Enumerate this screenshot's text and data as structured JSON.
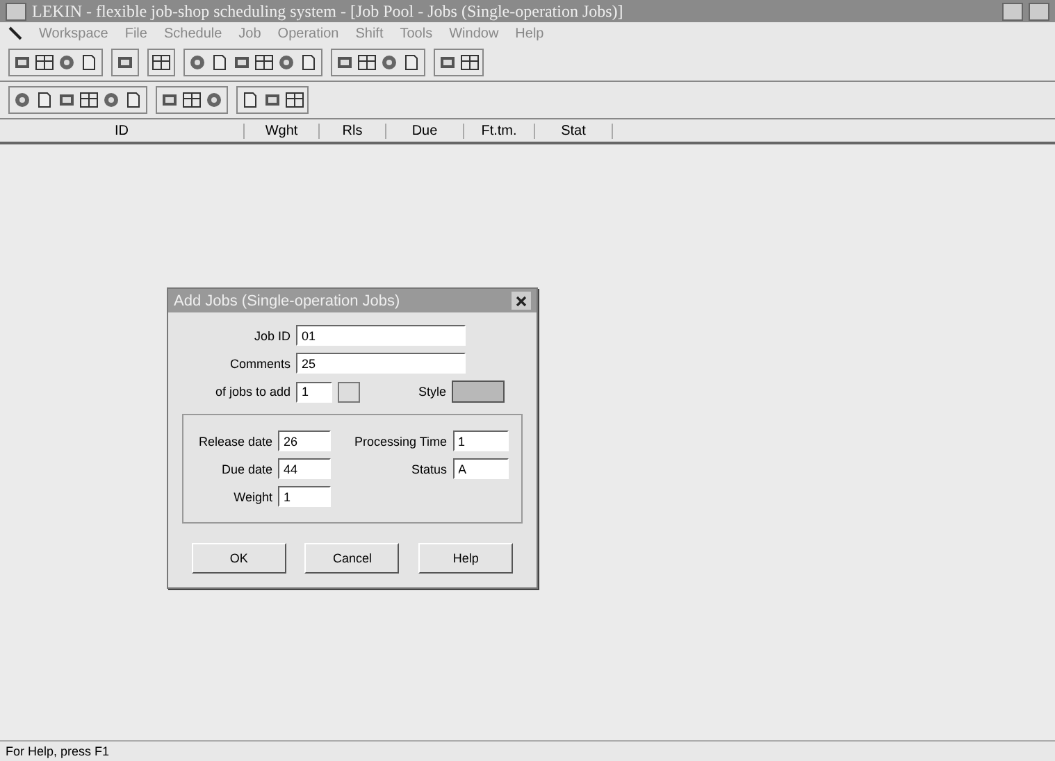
{
  "window": {
    "title": "LEKIN - flexible job-shop scheduling system - [Job Pool - Jobs (Single-operation Jobs)]"
  },
  "menu": [
    "Workspace",
    "File",
    "Schedule",
    "Job",
    "Operation",
    "Shift",
    "Tools",
    "Window",
    "Help"
  ],
  "table": {
    "columns": [
      "ID",
      "Wght",
      "Rls",
      "Due",
      "Ft.tm.",
      "Stat"
    ]
  },
  "dialog": {
    "title": "Add Jobs (Single-operation Jobs)",
    "job_id": {
      "label": "Job ID",
      "value": "01"
    },
    "comments": {
      "label": "Comments",
      "value": "25"
    },
    "jobs_to_add": {
      "label": "of jobs to add",
      "value": "1"
    },
    "style": {
      "label": "Style"
    },
    "fields_left": [
      {
        "label": "Release date",
        "value": "26"
      },
      {
        "label": "Due date",
        "value": "44"
      },
      {
        "label": "Weight",
        "value": "1"
      }
    ],
    "fields_right": [
      {
        "label": "Processing Time",
        "value": "1"
      },
      {
        "label": "Status",
        "value": "A"
      }
    ],
    "buttons": [
      "OK",
      "Cancel",
      "Help"
    ]
  },
  "status_bar": "For Help, press F1"
}
